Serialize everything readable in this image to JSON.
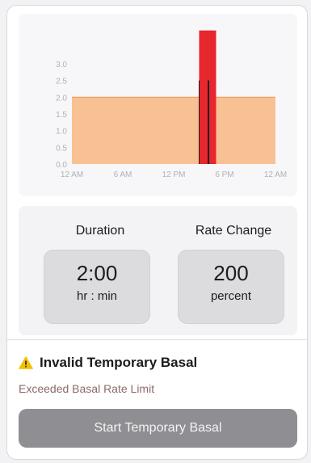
{
  "chart_data": {
    "type": "area",
    "x_tick_labels": [
      "12 AM",
      "6 AM",
      "12 PM",
      "6 PM",
      "12 AM"
    ],
    "y_tick_labels": [
      "0.0",
      "0.5",
      "1.0",
      "1.5",
      "2.0",
      "2.5",
      "3.0"
    ],
    "ylim": [
      0,
      3.0
    ],
    "xlim_hours": [
      0,
      24
    ],
    "scheduled_basal": {
      "rate": 2.0,
      "start_hour": 0,
      "end_hour": 24,
      "color": "#f8c194",
      "line_color": "#e8a060"
    },
    "temporary_basal": {
      "rate": 4.0,
      "start_hour": 15,
      "end_hour": 17,
      "color": "#e8262e"
    },
    "marker_hour": 16.1
  },
  "settings": {
    "duration": {
      "label": "Duration",
      "value": "2:00",
      "unit": "hr : min"
    },
    "rate_change": {
      "label": "Rate Change",
      "value": "200",
      "unit": "percent"
    }
  },
  "status": {
    "title": "Invalid Temporary Basal",
    "detail": "Exceeded Basal Rate Limit",
    "icon": "warning-triangle-icon",
    "icon_color": "#f2c200"
  },
  "actions": {
    "start_label": "Start Temporary Basal"
  }
}
